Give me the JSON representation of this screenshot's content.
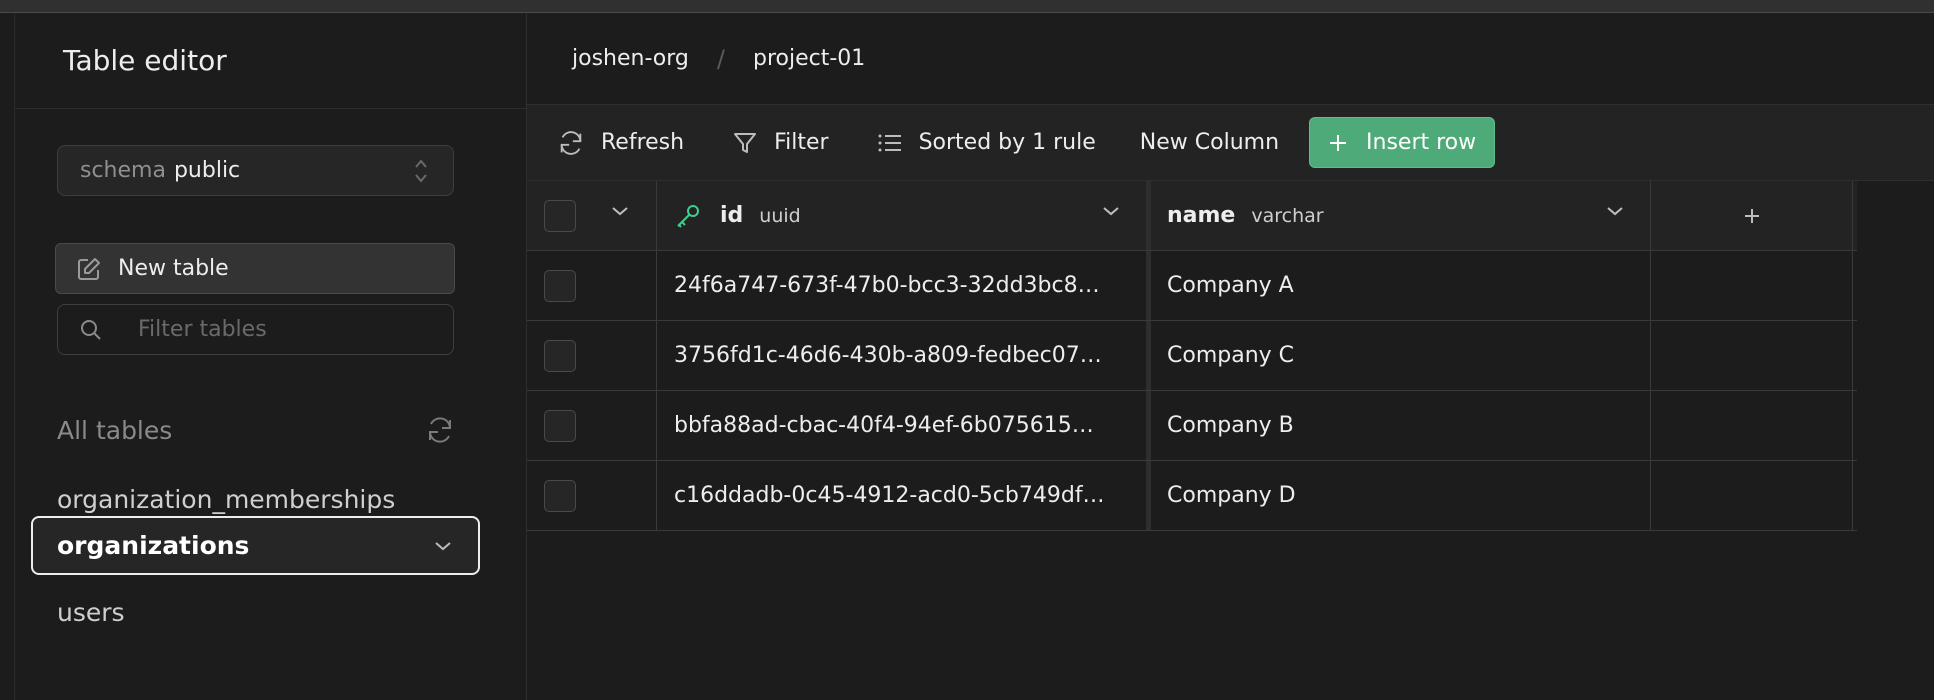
{
  "sidebar": {
    "title": "Table editor",
    "schema": {
      "prefix": "schema",
      "value": "public"
    },
    "new_table_label": "New table",
    "filter_placeholder": "Filter tables",
    "all_tables_label": "All tables",
    "tables": [
      {
        "label": "organization_memberships",
        "active": false
      },
      {
        "label": "organizations",
        "active": true
      },
      {
        "label": "users",
        "active": false
      }
    ]
  },
  "breadcrumb": {
    "org": "joshen-org",
    "separator": "/",
    "project": "project-01"
  },
  "toolbar": {
    "refresh_label": "Refresh",
    "filter_label": "Filter",
    "sort_label": "Sorted by 1 rule",
    "new_column_label": "New Column",
    "insert_row_label": "Insert row"
  },
  "grid": {
    "columns": [
      {
        "name": "id",
        "type": "uuid",
        "primary_key": true
      },
      {
        "name": "name",
        "type": "varchar",
        "primary_key": false
      }
    ],
    "add_column_symbol": "+",
    "rows": [
      {
        "id": "24f6a747-673f-47b0-bcc3-32dd3bc8…",
        "name": "Company A"
      },
      {
        "id": "3756fd1c-46d6-430b-a809-fedbec07…",
        "name": "Company C"
      },
      {
        "id": "bbfa88ad-cbac-40f4-94ef-6b075615…",
        "name": "Company B"
      },
      {
        "id": "c16ddadb-0c45-4912-acd0-5cb749df…",
        "name": "Company D"
      }
    ]
  },
  "colors": {
    "accent": "#4faa7a",
    "background": "#1c1c1c",
    "key_icon": "#3ecf8e"
  }
}
